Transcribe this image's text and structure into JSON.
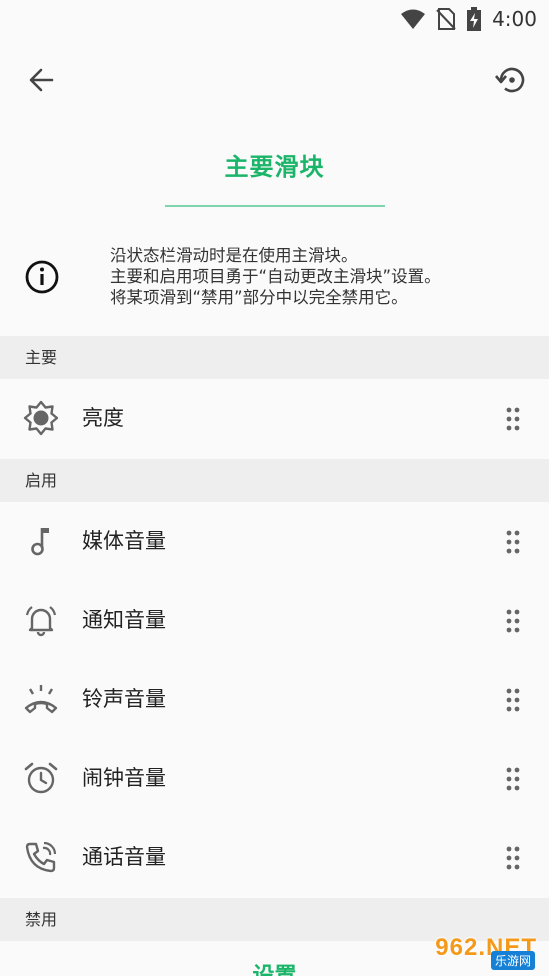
{
  "status": {
    "time": "4:00"
  },
  "title": "主要滑块",
  "info": {
    "line1": "沿状态栏滑动时是在使用主滑块。",
    "line2": "主要和启用项目勇于“自动更改主滑块”设置。",
    "line3": "将某项滑到“禁用”部分中以完全禁用它。"
  },
  "sections": {
    "primary": {
      "header": "主要",
      "items": [
        {
          "label": "亮度",
          "icon": "brightness-icon"
        }
      ]
    },
    "enabled": {
      "header": "启用",
      "items": [
        {
          "label": "媒体音量",
          "icon": "music-note-icon"
        },
        {
          "label": "通知音量",
          "icon": "bell-ring-icon"
        },
        {
          "label": "铃声音量",
          "icon": "phone-ring-icon"
        },
        {
          "label": "闹钟音量",
          "icon": "alarm-clock-icon"
        },
        {
          "label": "通话音量",
          "icon": "phone-call-icon"
        }
      ]
    },
    "disabled": {
      "header": "禁用"
    }
  },
  "bottom_button": "设置",
  "watermark": {
    "text": "962.NET",
    "sub": "乐游网"
  },
  "colors": {
    "accent": "#1bb56a",
    "icon": "#666666",
    "section_bg": "#eeeeee"
  }
}
